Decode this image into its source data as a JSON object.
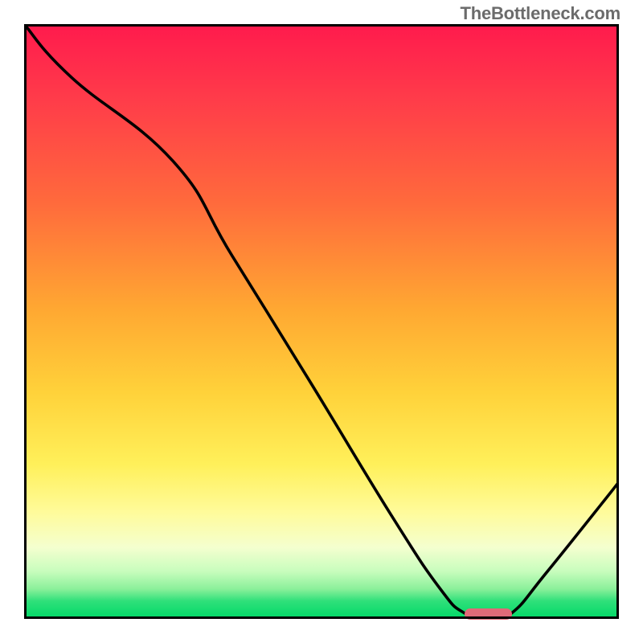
{
  "watermark": {
    "text": "TheBottleneck.com"
  },
  "chart_data": {
    "type": "line",
    "title": "",
    "xlabel": "",
    "ylabel": "",
    "xlim": [
      0,
      100
    ],
    "ylim": [
      0,
      100
    ],
    "grid": false,
    "legend": false,
    "background_gradient": {
      "description": "vertical red-to-green gradient, green at y=0",
      "top_color": "#ff1a4d",
      "bottom_color": "#00d967"
    },
    "series": [
      {
        "name": "bottleneck-curve",
        "x": [
          0,
          8,
          25,
          35,
          48,
          62,
          70,
          74,
          78,
          82,
          88,
          100
        ],
        "y": [
          100,
          91,
          77,
          61,
          40,
          17,
          5,
          1,
          0,
          1,
          8,
          23
        ],
        "color": "#000000",
        "linewidth": 3.6
      }
    ],
    "marker": {
      "name": "optimal-range-marker",
      "x_start": 74,
      "x_end": 82,
      "y": 0.8,
      "color": "#e06a78"
    }
  }
}
